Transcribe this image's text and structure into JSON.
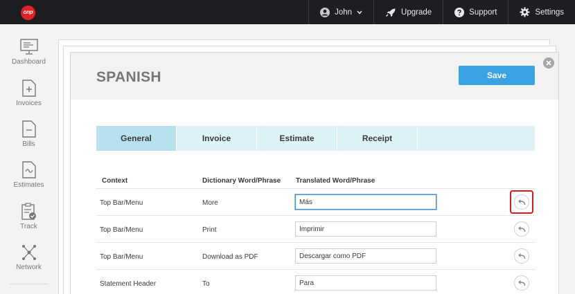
{
  "topbar": {
    "logo_text": "onp",
    "user_label": "John",
    "upgrade_label": "Upgrade",
    "support_label": "Support",
    "settings_label": "Settings"
  },
  "sidebar": {
    "items": [
      {
        "label": "Dashboard",
        "icon": "monitor-icon"
      },
      {
        "label": "Invoices",
        "icon": "invoice-plus-icon"
      },
      {
        "label": "Bills",
        "icon": "bill-minus-icon"
      },
      {
        "label": "Estimates",
        "icon": "estimate-icon"
      },
      {
        "label": "Track",
        "icon": "clipboard-check-icon"
      },
      {
        "label": "Network",
        "icon": "network-icon"
      }
    ]
  },
  "modal": {
    "title": "SPANISH",
    "save_label": "Save"
  },
  "tabs": [
    {
      "label": "General",
      "active": true
    },
    {
      "label": "Invoice",
      "active": false
    },
    {
      "label": "Estimate",
      "active": false
    },
    {
      "label": "Receipt",
      "active": false
    }
  ],
  "table": {
    "headers": {
      "context": "Context",
      "dictionary": "Dictionary Word/Phrase",
      "translated": "Translated Word/Phrase"
    },
    "rows": [
      {
        "context": "Top Bar/Menu",
        "dictionary": "More",
        "translated": "Más"
      },
      {
        "context": "Top Bar/Menu",
        "dictionary": "Print",
        "translated": "Imprimir"
      },
      {
        "context": "Top Bar/Menu",
        "dictionary": "Download as PDF",
        "translated": "Descargar como PDF"
      },
      {
        "context": "Statement Header",
        "dictionary": "To",
        "translated": "Para"
      }
    ]
  },
  "colors": {
    "accent": "#3aa3e3",
    "tab_active": "#b8e1f0",
    "tab_inactive": "#dcf3f7",
    "highlight": "#e2151d",
    "topbar": "#1d1e22"
  }
}
